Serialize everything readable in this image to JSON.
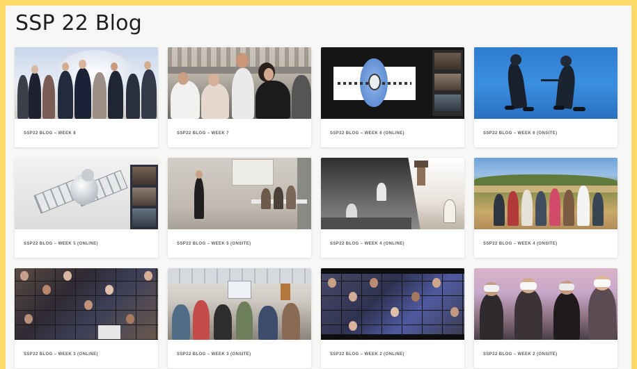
{
  "page": {
    "title": "SSP 22 Blog"
  },
  "posts": [
    {
      "title": "SSP22 BLOG – WEEK 8"
    },
    {
      "title": "SSP22 BLOG – WEEK 7"
    },
    {
      "title": "SSP22 BLOG – WEEK 6 (ONLINE)"
    },
    {
      "title": "SSP22 BLOG – WEEK 6 (ONSITE)"
    },
    {
      "title": "SSP22 BLOG – WEEK 5 (ONLINE)"
    },
    {
      "title": "SSP22 BLOG – WEEK 5 (ONSITE)"
    },
    {
      "title": "SSP22 BLOG – WEEK 4 (ONLINE)"
    },
    {
      "title": "SSP22 BLOG – WEEK 4 (ONSITE)"
    },
    {
      "title": "SSP22 BLOG – WEEK 3 (ONLINE)"
    },
    {
      "title": "SSP22 BLOG – WEEK 3 (ONSITE)"
    },
    {
      "title": "SSP22 BLOG – WEEK 2 (ONLINE)"
    },
    {
      "title": "SSP22 BLOG – WEEK 2 (ONSITE)"
    }
  ],
  "colors": {
    "page_bg": "#fdd968",
    "panel_bg": "#f7f7f5",
    "card_bg": "#ffffff",
    "title_text": "#1f1f1f",
    "caption_text": "#5c5c5c"
  }
}
